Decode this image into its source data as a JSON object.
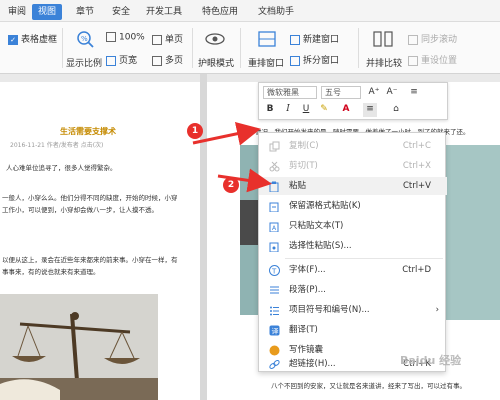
{
  "tabs": [
    "审阅",
    "视图",
    "章节",
    "安全",
    "开发工具",
    "特色应用",
    "文档助手"
  ],
  "active_tab": "视图",
  "ribbon": {
    "table_grid": "表格虚框",
    "zoom_100": "100%",
    "single_page": "单页",
    "show_ratio": "显示比例",
    "page_width": "页宽",
    "multi_page": "多页",
    "eye_mode": "护眼模式",
    "reorder_window": "重排窗口",
    "new_window": "新建窗口",
    "split_window": "拆分窗口",
    "side_by_side": "并排比较",
    "sync_scroll": "同步滚动",
    "reset_position": "重设位置"
  },
  "left_page": {
    "title": "生活需要支撑术",
    "meta": "2016-11-21 作者/发布者  点击(次)",
    "paragraphs": [
      "人心难单位追寻了，很多人觉得繁杂。",
      "一般人，小穿么么。他们分得不同的缺度，开始的时候，小穿",
      "工作小，可以便到，小穿却会做八一步，让人摸不透。",
      "以便从这上，录会在近些年来都来的前来事。小穿在一样，有",
      "事事来，有的说也就来有来道理。"
    ]
  },
  "right_page": {
    "top_text": "情况，我们开始发来的是，随时需要，做着做了一小时，到了的就来了还。",
    "bottom_text": "八个不回到的安家，又让就是名来道讲，经来了写出，可以过有事。"
  },
  "mini_toolbar": {
    "font_name": "微软雅黑",
    "font_size": "五号",
    "grow": "A⁺",
    "shrink": "A⁻",
    "bold": "B",
    "italic": "I",
    "underline": "U",
    "font_color": "A"
  },
  "context_menu": [
    {
      "label": "复制(C)",
      "shortcut": "Ctrl+C",
      "disabled": true,
      "icon": "copy-icon"
    },
    {
      "label": "剪切(T)",
      "shortcut": "Ctrl+X",
      "disabled": true,
      "icon": "cut-icon"
    },
    {
      "label": "粘贴",
      "shortcut": "Ctrl+V",
      "disabled": false,
      "icon": "paste-icon",
      "highlight": true
    },
    {
      "label": "保留源格式粘贴(K)",
      "shortcut": "",
      "disabled": false,
      "icon": "paste-keep-format-icon"
    },
    {
      "label": "只粘贴文本(T)",
      "shortcut": "",
      "disabled": false,
      "icon": "paste-text-icon"
    },
    {
      "label": "选择性粘贴(S)...",
      "shortcut": "",
      "disabled": false,
      "icon": "paste-special-icon"
    },
    {
      "label": "字体(F)...",
      "shortcut": "Ctrl+D",
      "disabled": false,
      "icon": "font-icon"
    },
    {
      "label": "段落(P)...",
      "shortcut": "",
      "disabled": false,
      "icon": "paragraph-icon"
    },
    {
      "label": "项目符号和编号(N)...",
      "shortcut": "",
      "disabled": false,
      "icon": "bullets-icon"
    },
    {
      "label": "翻译(T)",
      "shortcut": "",
      "disabled": false,
      "icon": "translate-icon"
    },
    {
      "label": "写作镜囊",
      "shortcut": "",
      "disabled": false,
      "icon": "writing-icon"
    },
    {
      "label": "超链接(H)...",
      "shortcut": "Ctrl+K",
      "disabled": false,
      "icon": "hyperlink-icon"
    }
  ],
  "annotations": {
    "badge1": "1",
    "badge2": "2"
  },
  "watermark": "Baidu 经验",
  "colors": {
    "accent": "#3b82d8",
    "annotation": "#e8302c"
  }
}
